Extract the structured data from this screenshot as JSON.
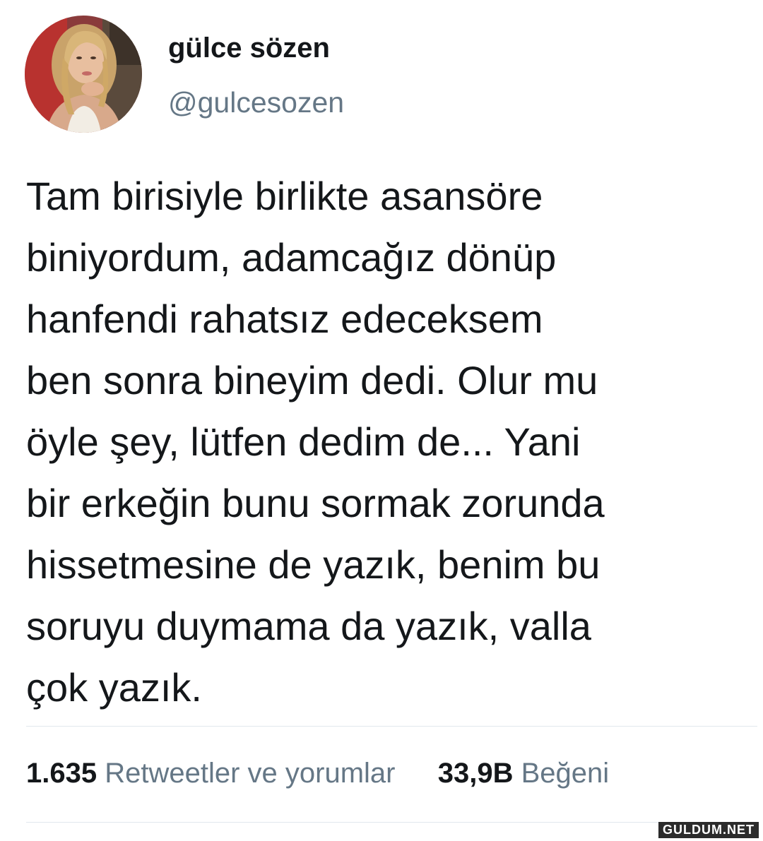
{
  "user": {
    "display_name": "gülce sözen",
    "handle": "@gulcesozen",
    "avatar": "profile-photo"
  },
  "tweet": {
    "lines": [
      "Tam birisiyle birlikte asansöre",
      "biniyordum, adamcağız dönüp",
      "hanfendi rahatsız edeceksem",
      "ben sonra bineyim dedi. Olur mu",
      "öyle şey, lütfen dedim de... Yani",
      "bir erkeğin bunu sormak zorunda",
      "hissetmesine de yazık, benim bu",
      "soruyu duymama da yazık, valla",
      "çok yazık."
    ]
  },
  "stats": {
    "retweets_count": "1.635",
    "retweets_label": "Retweetler ve yorumlar",
    "likes_count": "33,9B",
    "likes_label": "Beğeni"
  },
  "watermark": "GULDUM.NET"
}
